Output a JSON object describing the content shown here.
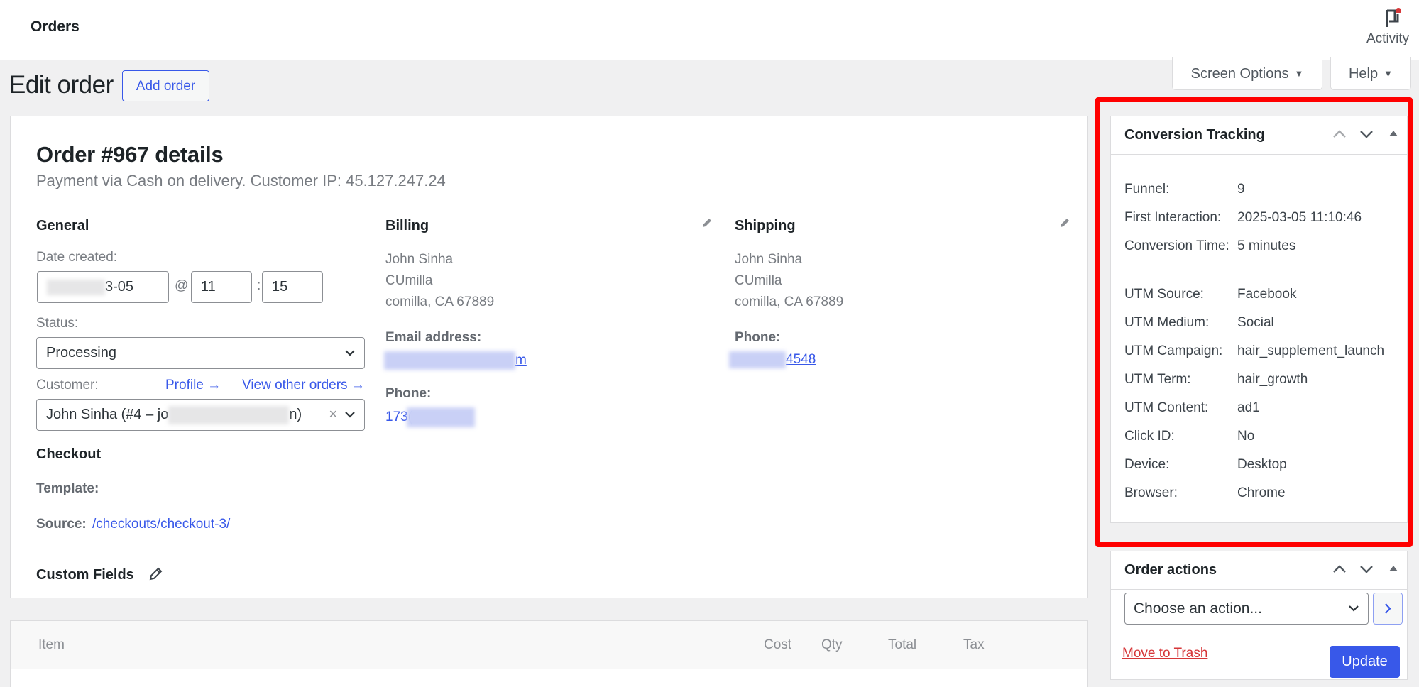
{
  "topbar": {
    "title": "Orders",
    "activity_label": "Activity"
  },
  "heading": {
    "title": "Edit order",
    "add_button": "Add order",
    "screen_options": "Screen Options",
    "help": "Help"
  },
  "order": {
    "title": "Order #967 details",
    "subtitle": "Payment via Cash on delivery. Customer IP: 45.127.247.24",
    "general": {
      "heading": "General",
      "date_label": "Date created:",
      "date_value_visible": "3-05",
      "at_symbol": "@",
      "hour": "11",
      "colon": ":",
      "minute": "15",
      "status_label": "Status:",
      "status_value": "Processing",
      "customer_label": "Customer:",
      "profile_link": "Profile →",
      "other_orders_link": "View other orders →",
      "customer_value_start": "John Sinha (#4 – jo",
      "customer_value_end": "n)",
      "clear_symbol": "×"
    },
    "checkout": {
      "heading": "Checkout",
      "template_label": "Template:",
      "source_label": "Source:",
      "source_link": "/checkouts/checkout-3/"
    },
    "custom_fields": {
      "heading": "Custom Fields"
    },
    "billing": {
      "heading": "Billing",
      "address_lines": [
        "John Sinha",
        "CUmilla",
        "comilla, CA 67889"
      ],
      "email_label": "Email address:",
      "email_visible_end": "m",
      "phone_label": "Phone:",
      "phone_visible_start": "173("
    },
    "shipping": {
      "heading": "Shipping",
      "address_lines": [
        "John Sinha",
        "CUmilla",
        "comilla, CA 67889"
      ],
      "phone_label": "Phone:",
      "phone_visible_end": "4548"
    }
  },
  "items_table": {
    "columns": [
      "Item",
      "Cost",
      "Qty",
      "Total",
      "Tax"
    ]
  },
  "conversion_tracking": {
    "title": "Conversion Tracking",
    "rows": [
      {
        "label": "Funnel:",
        "value": "9"
      },
      {
        "label": "First Interaction:",
        "value": "2025-03-05 11:10:46"
      },
      {
        "label": "Conversion Time:",
        "value": "5 minutes"
      },
      {
        "label": "UTM Source:",
        "value": "Facebook"
      },
      {
        "label": "UTM Medium:",
        "value": "Social"
      },
      {
        "label": "UTM Campaign:",
        "value": "hair_supplement_launch"
      },
      {
        "label": "UTM Term:",
        "value": "hair_growth"
      },
      {
        "label": "UTM Content:",
        "value": "ad1"
      },
      {
        "label": "Click ID:",
        "value": "No"
      },
      {
        "label": "Device:",
        "value": "Desktop"
      },
      {
        "label": "Browser:",
        "value": "Chrome"
      }
    ]
  },
  "order_actions": {
    "title": "Order actions",
    "select_value": "Choose an action...",
    "trash_link": "Move to Trash",
    "update_button": "Update"
  },
  "colors": {
    "accent": "#3858e9",
    "highlight_box": "#ff0000",
    "trash": "#d63638",
    "notification_dot": "#d63638"
  }
}
